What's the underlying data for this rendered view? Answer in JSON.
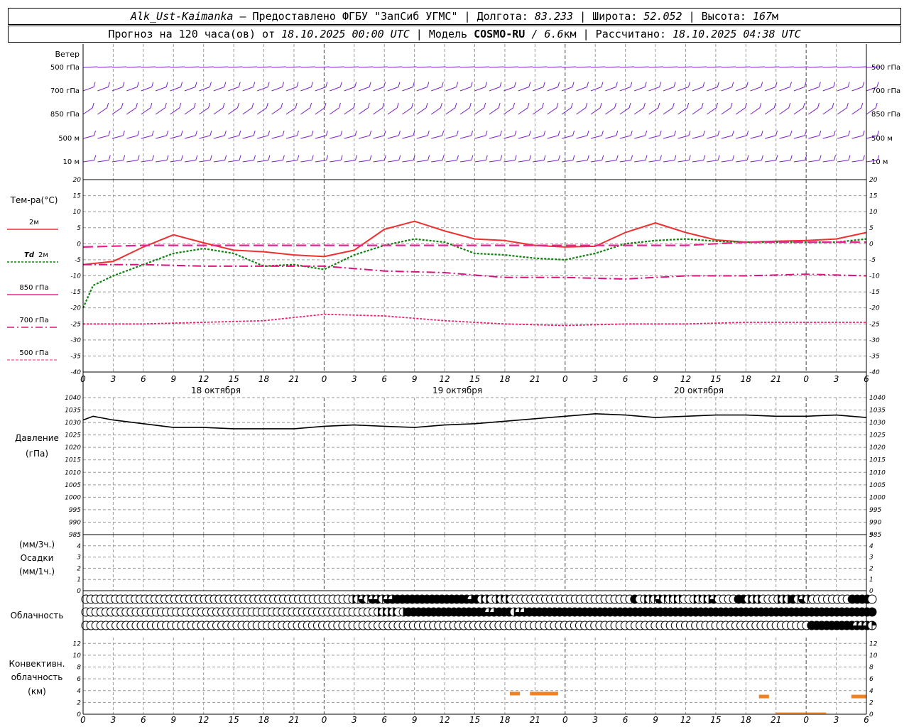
{
  "header": {
    "station": "Alk_Ust-Kaimanka",
    "provider": " — Предоставлено ФГБУ \"ЗапСиб УГМС\" | Долгота: ",
    "lon": "83.233",
    "lat_label": " | Широта: ",
    "lat": "52.052",
    "alt_label": " | Высота: ",
    "alt": "167",
    "alt_unit": "м",
    "forecast_label": "Прогноз на 120 часа(ов) от ",
    "run": "18.10.2025 00:00 UTC",
    "model_label": " | Модель ",
    "model": "COSMO-RU",
    "res": " / 6.6",
    "res_unit": "км",
    "calc_label": " | Рассчитано: ",
    "calc": "18.10.2025 04:38 UTC"
  },
  "labels": {
    "wind": "Ветер",
    "wind_levels": [
      "500 гПа",
      "700 гПа",
      "850 гПа",
      "500 м",
      "10 м"
    ],
    "temp": "Тем-ра(°С)",
    "t2m": "2м",
    "td": "Td",
    "td_h": "2м",
    "t850": "850 гПа",
    "t700": "700 гПа",
    "t500": "500 гПа",
    "pressure": "Давление",
    "pressure_unit": "(гПа)",
    "precip_unit3": "(мм/3ч.)",
    "precip": "Осадки",
    "precip_unit1": "(мм/1ч.)",
    "cloud": "Облачность",
    "conv1": "Конвективн.",
    "conv2": "облачность",
    "conv_unit": "(км)"
  },
  "colors": {
    "t2m": "#ee3030",
    "td": "#108010",
    "t850": "#ee2090",
    "t700": "#dd1080",
    "t500": "#ee2070",
    "wind": "#7a20c8",
    "conv": "#f08020",
    "grid": "#9a9a9a"
  },
  "chart_data": [
    {
      "type": "line",
      "name": "wind",
      "levels": [
        "500 гПа",
        "700 гПа",
        "850 гПа",
        "500 м",
        "10 м"
      ]
    },
    {
      "type": "line",
      "name": "temperature",
      "ylim": [
        -40,
        20
      ],
      "yticks": [
        -40,
        -35,
        -30,
        -25,
        -20,
        -15,
        -10,
        -5,
        0,
        5,
        10,
        15,
        20
      ],
      "xticks": [
        "0",
        "3",
        "6",
        "9",
        "12",
        "15",
        "18",
        "21",
        "0",
        "3",
        "6",
        "9",
        "12",
        "15",
        "18",
        "21",
        "0",
        "3",
        "6",
        "9",
        "12",
        "15",
        "18",
        "21",
        "0",
        "3",
        "6"
      ],
      "dates": [
        "18 октября",
        "19 октября",
        "20 октября"
      ],
      "series": [
        {
          "name": "2м",
          "x": [
            0,
            3,
            6,
            9,
            12,
            15,
            18,
            21,
            24,
            27,
            30,
            33,
            36,
            39,
            42,
            45,
            48,
            51,
            54,
            57,
            60,
            63,
            66,
            69,
            72,
            75,
            78
          ],
          "values": [
            -6.5,
            -5.5,
            -1,
            2.8,
            0.3,
            -2,
            -2.5,
            -3.5,
            -4,
            -2,
            4.5,
            7,
            4,
            1.5,
            1,
            -0.5,
            -1,
            -0.8,
            3.5,
            6.5,
            3.5,
            1.2,
            0.5,
            0.8,
            1,
            1.5,
            3.5
          ]
        },
        {
          "name": "Td 2м",
          "x": [
            0,
            1,
            3,
            6,
            9,
            12,
            15,
            18,
            21,
            24,
            27,
            30,
            33,
            36,
            39,
            42,
            45,
            48,
            51,
            54,
            57,
            60,
            63,
            66,
            69,
            72,
            75,
            78
          ],
          "values": [
            -20,
            -13,
            -10,
            -6.5,
            -3,
            -1.5,
            -3,
            -7,
            -6.5,
            -8,
            -3.5,
            -0.5,
            1.5,
            0.5,
            -3,
            -3.5,
            -4.5,
            -5,
            -3,
            0,
            1,
            1.5,
            0.8,
            0.5,
            0.5,
            0.5,
            0.5,
            1.5
          ]
        },
        {
          "name": "850 гПа",
          "x": [
            0,
            6,
            12,
            18,
            24,
            30,
            36,
            42,
            48,
            54,
            60,
            66,
            72,
            78
          ],
          "values": [
            -1,
            -0.5,
            -0.5,
            -0.5,
            -0.5,
            -0.5,
            -0.5,
            -0.5,
            -0.5,
            -0.5,
            -0.5,
            0.5,
            0.5,
            0.5
          ]
        },
        {
          "name": "700 гПа",
          "x": [
            0,
            6,
            12,
            18,
            24,
            30,
            36,
            42,
            48,
            54,
            60,
            66,
            72,
            78
          ],
          "values": [
            -6.5,
            -6.5,
            -7,
            -7,
            -7,
            -8.5,
            -9,
            -10.5,
            -10.5,
            -11,
            -10,
            -10,
            -9.5,
            -10
          ]
        },
        {
          "name": "500 гПа",
          "x": [
            0,
            6,
            12,
            18,
            24,
            30,
            36,
            42,
            48,
            54,
            60,
            66,
            72,
            78
          ],
          "values": [
            -25,
            -25,
            -24.5,
            -24,
            -22,
            -22.5,
            -24,
            -25,
            -25.5,
            -25,
            -25,
            -24.5,
            -24.5,
            -24.5
          ]
        }
      ]
    },
    {
      "type": "line",
      "name": "pressure",
      "ylim": [
        985,
        1040
      ],
      "yticks": [
        985,
        990,
        995,
        1000,
        1005,
        1010,
        1015,
        1020,
        1025,
        1030,
        1035,
        1040
      ],
      "x": [
        0,
        1,
        3,
        6,
        9,
        12,
        15,
        18,
        21,
        24,
        27,
        30,
        33,
        36,
        39,
        42,
        45,
        48,
        51,
        54,
        57,
        60,
        63,
        66,
        69,
        72,
        75,
        78
      ],
      "values": [
        1031,
        1032.5,
        1031,
        1029.5,
        1028,
        1028,
        1027.5,
        1027.5,
        1027.5,
        1028.5,
        1029,
        1028.5,
        1028,
        1029,
        1029.5,
        1030.5,
        1031.5,
        1032.5,
        1033.5,
        1033,
        1032,
        1032.5,
        1033,
        1033,
        1032.5,
        1032.5,
        1033,
        1032
      ]
    },
    {
      "type": "bar",
      "name": "precipitation",
      "ylim": [
        0,
        5
      ],
      "yticks": [
        0,
        1,
        2,
        3,
        4,
        5
      ],
      "values": []
    },
    {
      "type": "table",
      "name": "cloudiness",
      "rows": [
        "0000000000000000000000000000000000000000000000000000002131331334444444444444443422021200000000000000000000000004021131121002122300004422200022241310000000044440",
        "0000000000000000000000000000000000000000000000000000000000222202444444444444444433444233444444444444444444444444444444444444444444444444444444444444444444444",
        "0000000000000000000000000000000000000000000000000000000000000000000000000000000000000000000000000000000000000000000000000000000000000000000000004444444443331"
      ]
    },
    {
      "type": "bar",
      "name": "convective",
      "ylim": [
        0,
        13
      ],
      "yticks": [
        0,
        2,
        4,
        6,
        8,
        10,
        12
      ],
      "segments": [
        [
          42.5,
          43.5,
          3.5
        ],
        [
          44.5,
          47.3,
          3.5
        ],
        [
          67.3,
          68.3,
          3
        ],
        [
          76.5,
          78,
          3
        ],
        [
          69.0,
          74.0,
          0.2
        ]
      ]
    }
  ]
}
